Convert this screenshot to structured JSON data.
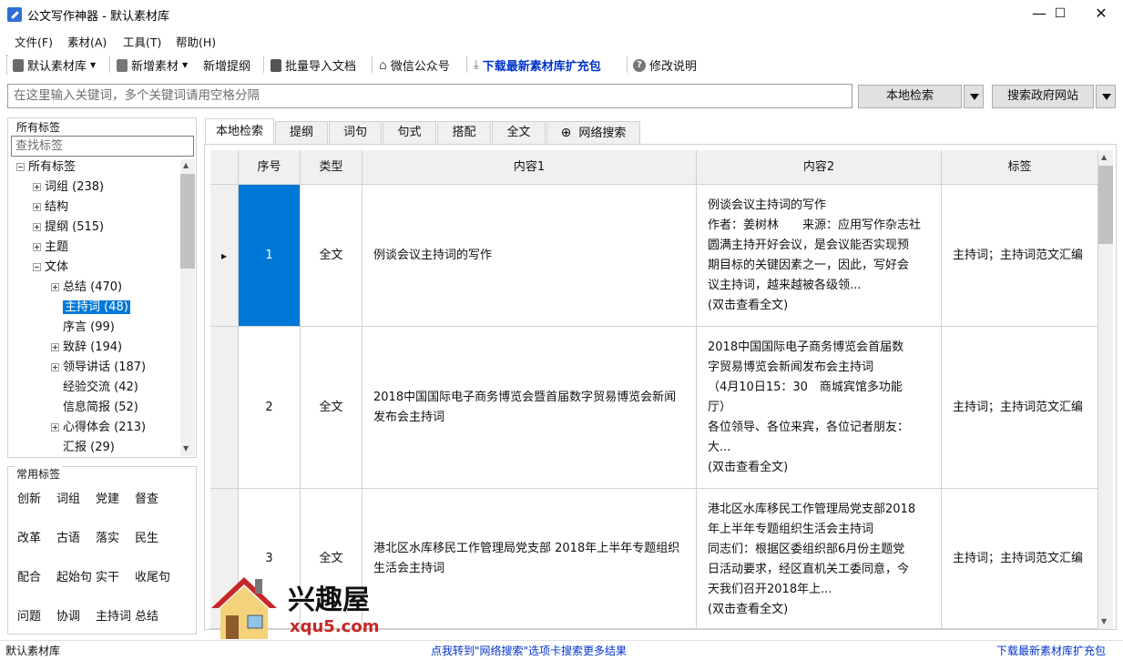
{
  "window": {
    "title": "公文写作神器 - 默认素材库",
    "minimize": "—",
    "maximize": "☐",
    "close": "✕"
  },
  "menu": [
    "文件(F)",
    "素材(A)",
    "工具(T)",
    "帮助(H)"
  ],
  "toolbar": {
    "library": "默认素材库",
    "new_material": "新增素材",
    "new_outline": "新增提纲",
    "batch_import": "批量导入文档",
    "wechat": "微信公众号",
    "download": "下载最新素材库扩充包",
    "changelog": "修改说明"
  },
  "search": {
    "placeholder": "在这里输入关键词，多个关键词请用空格分隔",
    "local_button": "本地检索",
    "gov_button": "搜索政府网站"
  },
  "tags": {
    "title": "所有标签",
    "search_placeholder": "查找标签",
    "tree": [
      {
        "label": "所有标签",
        "level": 0,
        "exp": "minus"
      },
      {
        "label": "词组 (238)",
        "level": 1,
        "exp": "plus"
      },
      {
        "label": "结构",
        "level": 1,
        "exp": "plus"
      },
      {
        "label": "提纲 (515)",
        "level": 1,
        "exp": "plus"
      },
      {
        "label": "主题",
        "level": 1,
        "exp": "plus"
      },
      {
        "label": "文体",
        "level": 1,
        "exp": "minus"
      },
      {
        "label": "总结 (470)",
        "level": 2,
        "exp": "plus"
      },
      {
        "label": "主持词 (48)",
        "level": 2,
        "exp": "none",
        "selected": true
      },
      {
        "label": "序言 (99)",
        "level": 2,
        "exp": "none"
      },
      {
        "label": "致辞 (194)",
        "level": 2,
        "exp": "plus"
      },
      {
        "label": "领导讲话 (187)",
        "level": 2,
        "exp": "plus"
      },
      {
        "label": "经验交流 (42)",
        "level": 2,
        "exp": "none"
      },
      {
        "label": "信息简报 (52)",
        "level": 2,
        "exp": "none"
      },
      {
        "label": "心得体会 (213)",
        "level": 2,
        "exp": "plus"
      },
      {
        "label": "汇报 (29)",
        "level": 2,
        "exp": "none"
      }
    ]
  },
  "common_tags": {
    "title": "常用标签",
    "items": [
      "创新",
      "词组",
      "党建",
      "督查",
      "改革",
      "古语",
      "落实",
      "民生",
      "配合",
      "起始句",
      "实干",
      "收尾句",
      "问题",
      "协调",
      "主持词",
      "总结"
    ]
  },
  "tabs": [
    "本地检索",
    "提纲",
    "词句",
    "句式",
    "搭配",
    "全文",
    "网络搜索"
  ],
  "table": {
    "headers": [
      "序号",
      "类型",
      "内容1",
      "内容2",
      "标签"
    ],
    "rows": [
      {
        "no": "1",
        "type": "全文",
        "c1": "例谈会议主持词的写作",
        "c2": [
          "例谈会议主持词的写作",
          "作者：姜树林　　来源：应用写作杂志社",
          "圆满主持开好会议，是会议能否实现预",
          "期目标的关键因素之一，因此，写好会",
          "议主持词，越来越被各级领...",
          "(双击查看全文)"
        ],
        "tag": "主持词；主持词范文汇编"
      },
      {
        "no": "2",
        "type": "全文",
        "c1": "2018中国国际电子商务博览会暨首届数字贸易博览会新闻发布会主持词",
        "c2": [
          "2018中国国际电子商务博览会首届数",
          "字贸易博览会新闻发布会主持词",
          "（4月10日15：30　商城宾馆多功能",
          "厅）",
          "各位领导、各位来宾，各位记者朋友：",
          "大...",
          "(双击查看全文)"
        ],
        "tag": "主持词；主持词范文汇编"
      },
      {
        "no": "3",
        "type": "全文",
        "c1": "港北区水库移民工作管理局党支部 2018年上半年专题组织生活会主持词",
        "c2": [
          "港北区水库移民工作管理局党支部2018",
          "年上半年专题组织生活会主持词",
          "同志们：根据区委组织部6月份主题党",
          "日活动要求，经区直机关工委同意，今",
          "天我们召开2018年上...",
          "(双击查看全文)"
        ],
        "tag": "主持词；主持词范文汇编"
      }
    ]
  },
  "status": {
    "left": "默认素材库",
    "center": "点我转到\"网络搜索\"选项卡搜索更多结果",
    "right": "下载最新素材库扩充包"
  },
  "watermark": {
    "text": "兴趣屋",
    "url": "xqu5.com"
  },
  "colors": {
    "selection": "#0078d7",
    "link": "#0033cc"
  }
}
